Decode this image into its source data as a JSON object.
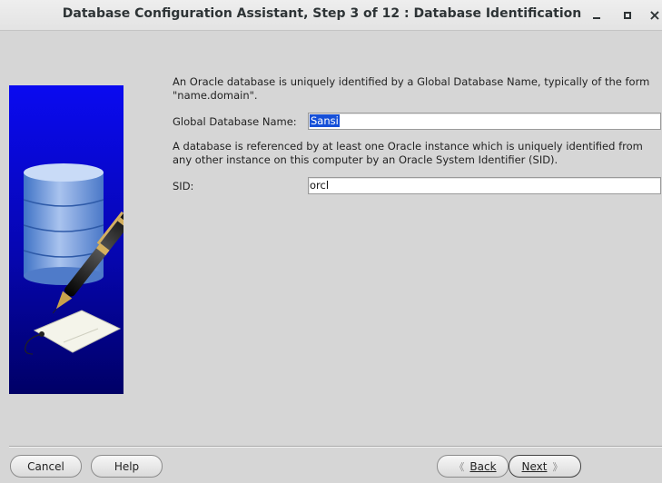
{
  "window": {
    "title": "Database Configuration Assistant, Step 3 of 12 : Database Identification",
    "minimize_icon": "minimize-icon",
    "maximize_icon": "maximize-icon",
    "close_icon": "close-icon",
    "close_glyph": "×"
  },
  "main": {
    "intro_text": "An Oracle database is uniquely identified by a Global Database Name, typically of the form \"name.domain\".",
    "global_db_name_label": "Global Database Name:",
    "global_db_name_value": "Sansi",
    "sid_intro_text": "A database is referenced by at least one Oracle instance which is uniquely identified from any other instance on this computer by an Oracle System Identifier (SID).",
    "sid_label": "SID:",
    "sid_value": "orcl"
  },
  "side_image": {
    "icon": "database-pen-illustration",
    "colors": {
      "top": "#0a0af0",
      "bottom": "#000066"
    }
  },
  "footer": {
    "cancel_label": "Cancel",
    "help_label": "Help",
    "back_label": "Back",
    "next_label": "Next",
    "back_arrow": "《",
    "next_arrow": "》"
  },
  "colors": {
    "selection": "#1650d8",
    "background": "#d6d6d6"
  }
}
